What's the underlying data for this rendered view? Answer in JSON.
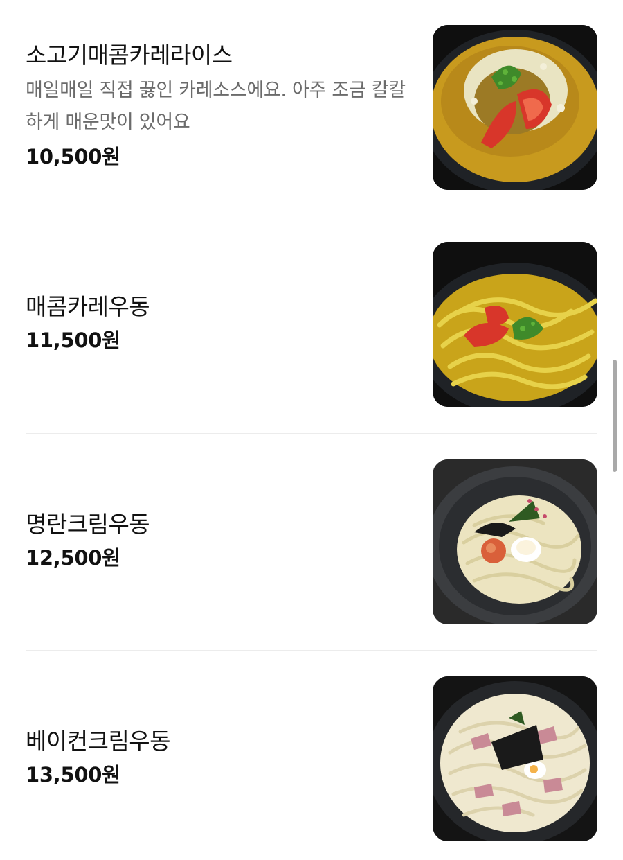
{
  "menu": {
    "items": [
      {
        "name": "소고기매콤카레라이스",
        "description": "매일매일 직접 끓인 카레소스에요. 아주 조금 칼칼하게 매운맛이 있어요",
        "price": "10,500원"
      },
      {
        "name": "매콤카레우동",
        "description": "",
        "price": "11,500원"
      },
      {
        "name": "명란크림우동",
        "description": "",
        "price": "12,500원"
      },
      {
        "name": "베이컨크림우동",
        "description": "",
        "price": "13,500원"
      }
    ]
  },
  "colors": {
    "text_primary": "#111111",
    "text_secondary": "#6b6b6b",
    "divider": "#ececec",
    "scrollbar": "#a9a9a9"
  }
}
